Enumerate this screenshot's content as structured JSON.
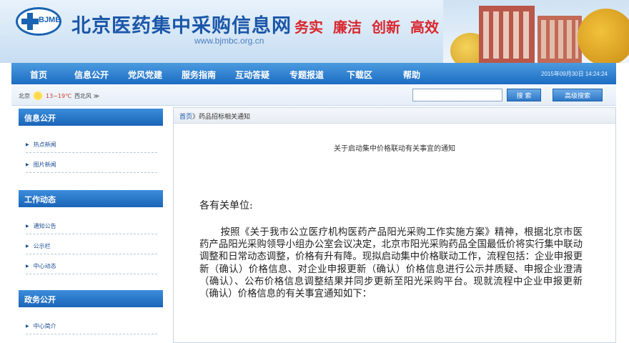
{
  "header": {
    "logo_text": "BJMB",
    "site_title": "北京医药集中采购信息网",
    "site_url": "www.bjmbc.org.cn",
    "slogans": [
      "务实",
      "廉洁",
      "创新",
      "高效"
    ]
  },
  "nav": {
    "items": [
      "首页",
      "信息公开",
      "党风党建",
      "服务指南",
      "互动答疑",
      "专题报道",
      "下载区",
      "帮助"
    ],
    "datetime": "2015年09月30日 14:24:24"
  },
  "subbar": {
    "weather_city": "北京",
    "weather_temp": "13~19℃",
    "weather_wind": "西北风 ≫",
    "search_placeholder": "",
    "search_button": "搜 索",
    "advanced_button": "高级搜索"
  },
  "sidebar": {
    "sections": [
      {
        "title": "信息公开",
        "items": [
          "热点新闻",
          "图片新闻"
        ]
      },
      {
        "title": "工作动态",
        "items": [
          "通知公告",
          "公示栏",
          "中心动态"
        ]
      },
      {
        "title": "政务公开",
        "items": [
          "中心简介"
        ]
      }
    ]
  },
  "main": {
    "breadcrumb_home": "首页",
    "breadcrumb_sep": "》",
    "breadcrumb_current": "药品招标相关通知",
    "article_title": "关于启动集中价格联动有关事宜的通知",
    "salutation": "各有关单位:",
    "body": "按照《关于我市公立医疗机构医药产品阳光采购工作实施方案》精神，根据北京市医药产品阳光采购领导小组办公室会议决定，北京市阳光采购药品全国最低价将实行集中联动调整和日常动态调整，价格有升有降。现拟启动集中价格联动工作，流程包括：企业申报更新（确认）价格信息、对企业申报更新（确认）价格信息进行公示并质疑、申报企业澄清（确认）、公布价格信息调整结果并同步更新至阳光采购平台。现就流程中企业申报更新（确认）价格信息的有关事宜通知如下："
  },
  "colors": {
    "nav_blue": "#1c6cc3",
    "title_blue": "#1b57a8",
    "slogan_red": "#d9272e"
  }
}
